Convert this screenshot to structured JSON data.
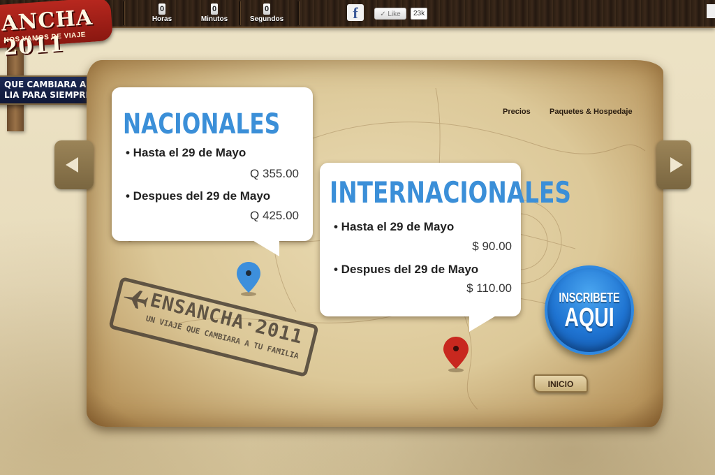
{
  "header": {
    "logo_text": "ANCHA 2011",
    "logo_tagline": "NOS VAMOS DE VIAJE",
    "slogan_line1": "QUE CAMBIARA A",
    "slogan_line2": "LIA PARA SIEMPRE",
    "countdown": [
      {
        "value": "0",
        "label": "Horas"
      },
      {
        "value": "0",
        "label": "Minutos"
      },
      {
        "value": "0",
        "label": "Segundos"
      }
    ],
    "facebook_glyph": "f",
    "like_label": "✓ Like",
    "like_count": "23k"
  },
  "nav": {
    "items": [
      "Precios",
      "Paquetes & Hospedaje"
    ]
  },
  "nacionales": {
    "title": "NACIONALES",
    "items": [
      {
        "label": "• Hasta el 29 de Mayo",
        "price": "Q 355.00"
      },
      {
        "label": "• Despues del 29 de Mayo",
        "price": "Q 425.00"
      }
    ]
  },
  "internacionales": {
    "title": "INTERNACIONALES",
    "items": [
      {
        "label": "• Hasta el 29 de Mayo",
        "price": "$ 90.00"
      },
      {
        "label": "• Despues del 29 de Mayo",
        "price": "$ 110.00"
      }
    ]
  },
  "stamp": {
    "line1": "ENSANCHA·2011",
    "line2": "UN VIAJE QUE CAMBIARA A TU FAMILIA"
  },
  "cta": {
    "line1": "INSCRIBETE",
    "line2": "AQUI"
  },
  "inicio_label": "INICIO",
  "colors": {
    "title_blue": "#3b8fd8",
    "cta_blue": "#1f74d2",
    "pin_blue": "#3d8fdc",
    "pin_red": "#c8281f",
    "logo_red": "#b8281f"
  },
  "icons": [
    "facebook-icon",
    "like-check-icon",
    "arrow-left-icon",
    "arrow-right-icon",
    "map-pin-icon",
    "plane-icon"
  ]
}
